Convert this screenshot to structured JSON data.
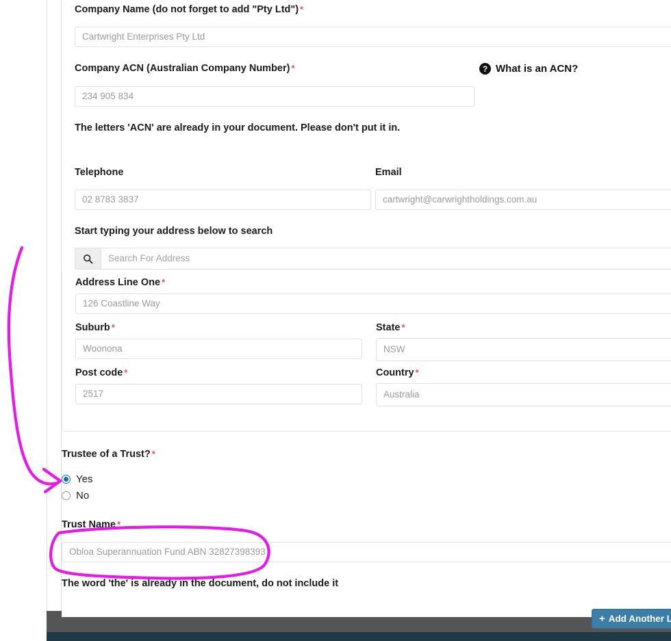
{
  "form": {
    "company_name": {
      "label": "Company Name (do not forget to add \"Pty Ltd\")",
      "required_mark": "*",
      "value": "Cartwright Enterprises Pty Ltd"
    },
    "company_acn": {
      "label": "Company ACN (Australian Company Number)",
      "required_mark": "*",
      "value": "234 905 834",
      "help_link": "What is an ACN?",
      "help_icon": "question-circle-icon",
      "note": "The letters 'ACN' are already in your document. Please don't put it in."
    },
    "telephone": {
      "label": "Telephone",
      "value": "02 8783 3837"
    },
    "email": {
      "label": "Email",
      "value": "cartwright@carwrightholdings.com.au"
    },
    "address_search": {
      "label": "Start typing your address below to search",
      "placeholder": "Search For Address",
      "icon": "search-icon"
    },
    "address_line_one": {
      "label": "Address Line One",
      "required_mark": "*",
      "value": "126 Coastline Way"
    },
    "suburb": {
      "label": "Suburb",
      "required_mark": "*",
      "value": "Woonona"
    },
    "state": {
      "label": "State",
      "required_mark": "*",
      "value": "NSW"
    },
    "post_code": {
      "label": "Post code",
      "required_mark": "*",
      "value": "2517"
    },
    "country": {
      "label": "Country",
      "required_mark": "*",
      "value": "Australia"
    },
    "trustee": {
      "label": "Trustee of a Trust?",
      "required_mark": "*",
      "options": [
        {
          "label": "Yes",
          "selected": true
        },
        {
          "label": "No",
          "selected": false
        }
      ]
    },
    "trust_name": {
      "label": "Trust Name",
      "required_mark": "*",
      "value": "Obloa Superannuation Fund ABN 32827398393",
      "note": "The word 'the' is already in the document, do not include it"
    }
  },
  "footer": {
    "add_another_label": "Add Another Le",
    "add_another_plus": "+"
  },
  "colors": {
    "required_asterisk": "#e05260",
    "radio_selected": "#1669c7",
    "annotation": "#e619e6",
    "button_blue": "#3b7ea8",
    "footer_gray": "#555555",
    "footer_teal": "#1f3a44"
  }
}
